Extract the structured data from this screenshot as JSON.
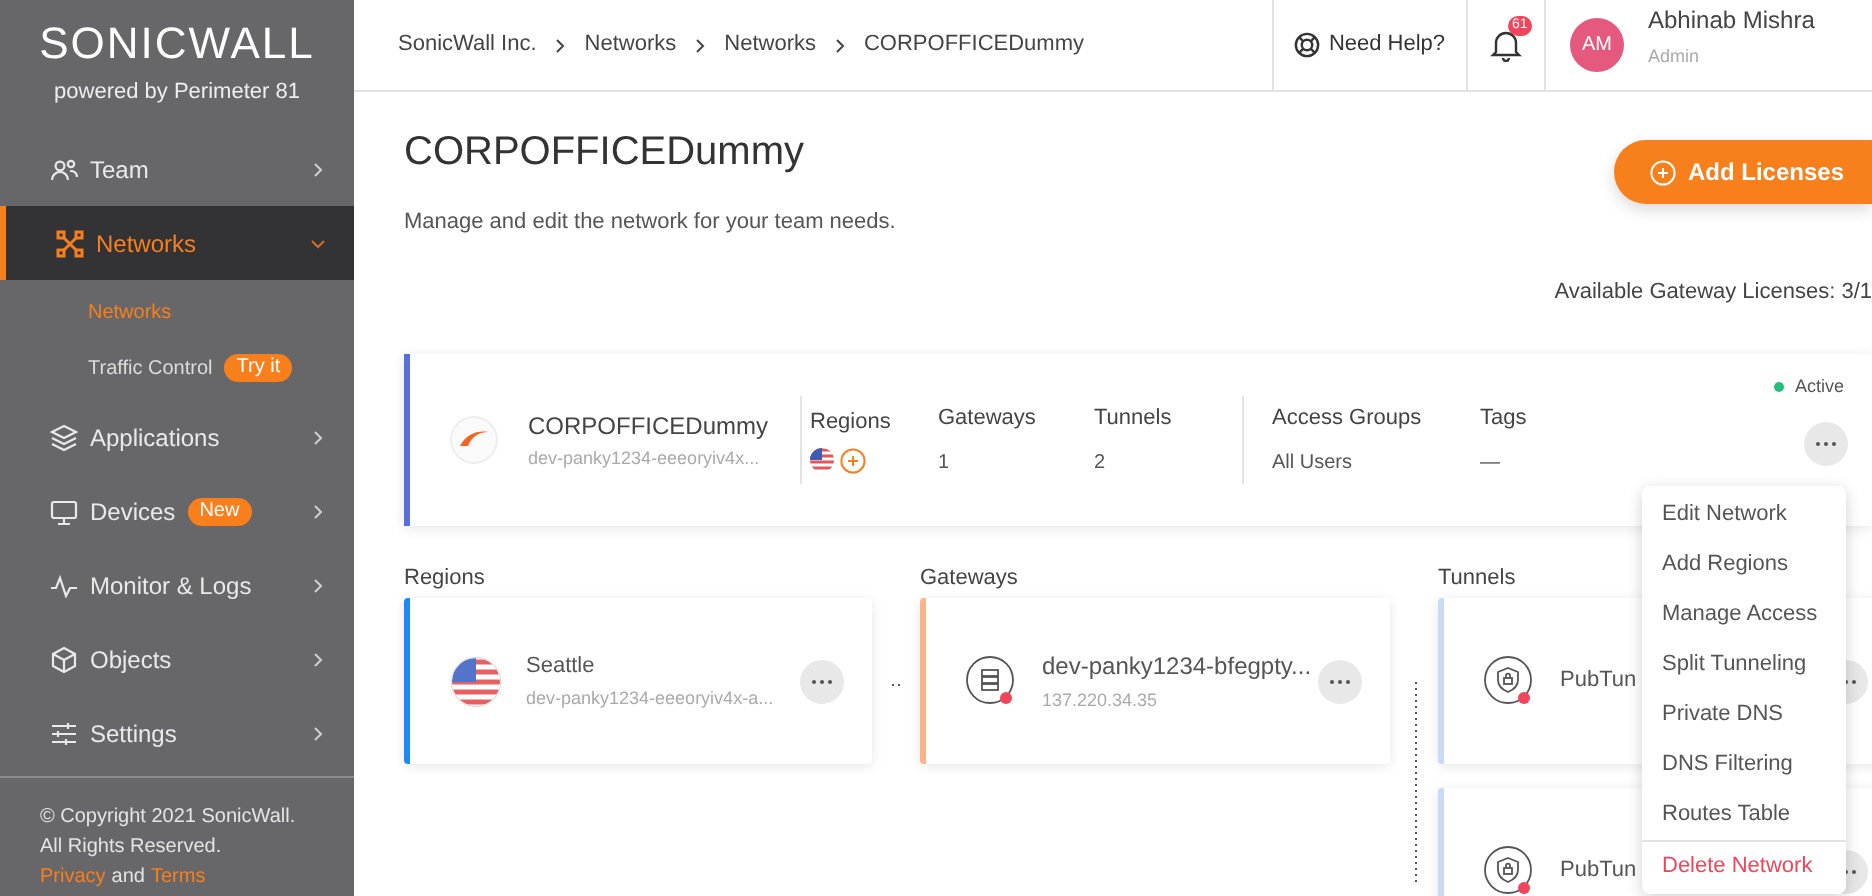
{
  "sidebar": {
    "logo": "SONIC**WALL**",
    "tagline": "powered by Perimeter 81",
    "items": [
      {
        "label": "Team",
        "selected": false,
        "expanded": false
      },
      {
        "label": "Networks",
        "selected": true,
        "expanded": true,
        "children": [
          {
            "label": "Networks",
            "selected": true
          },
          {
            "label": "Traffic Control",
            "selected": false,
            "badge": "Try it"
          }
        ]
      },
      {
        "label": "Applications",
        "selected": false,
        "expanded": false
      },
      {
        "label": "Devices",
        "selected": false,
        "expanded": false,
        "badge": "New"
      },
      {
        "label": "Monitor & Logs",
        "selected": false,
        "expanded": false
      },
      {
        "label": "Objects",
        "selected": false,
        "expanded": false
      },
      {
        "label": "Settings",
        "selected": false,
        "expanded": false
      }
    ],
    "footer": {
      "copyright": "© Copyright 2021 SonicWall. All Rights Reserved.",
      "privacy": "Privacy",
      "and": "and",
      "terms": "Terms"
    }
  },
  "header": {
    "breadcrumbs": [
      "SonicWall Inc.",
      "Networks",
      "Networks",
      "CORPOFFICEDummy"
    ],
    "help": "Need Help?",
    "notifications": "61",
    "user": {
      "initials": "AM",
      "name": "Abhinab Mishra",
      "role": "Admin"
    }
  },
  "page": {
    "title": "CORPOFFICEDummy",
    "subtitle": "Manage and edit the network for your team needs.",
    "add_button": "Add Licenses",
    "licenses": "Available Gateway Licenses: 3/1"
  },
  "network": {
    "name": "CORPOFFICEDummy",
    "subtitle": "dev-panky1234-eeeoryiv4x...",
    "status": "Active",
    "columns": [
      {
        "label": "Regions",
        "kind": "icons"
      },
      {
        "label": "Gateways",
        "kind": "text",
        "value": "1"
      },
      {
        "label": "Tunnels",
        "kind": "text",
        "value": "2"
      },
      {
        "label": "Access Groups",
        "kind": "text",
        "value": "All Users"
      },
      {
        "label": "Tags",
        "kind": "text",
        "value": "—"
      }
    ]
  },
  "sections": [
    {
      "title": "Regions",
      "cards": [
        {
          "kind": "region",
          "name": "Seattle",
          "detail": "dev-panky1234-eeeoryiv4x-a...",
          "color": "#1e88f5"
        }
      ]
    },
    {
      "title": "Gateways",
      "cards": [
        {
          "kind": "gateway",
          "name": "dev-panky1234-bfegpty...",
          "detail": "137.220.34.35",
          "color": "#f9b58a"
        }
      ]
    },
    {
      "title": "Tunnels",
      "cards": [
        {
          "kind": "tunnel",
          "name": "PubTun",
          "color": "#c8daf6"
        },
        {
          "kind": "tunnel",
          "name": "PubTun",
          "color": "#c8daf6"
        }
      ]
    }
  ],
  "menu": [
    {
      "label": "Edit Network",
      "danger": false
    },
    {
      "label": "Add Regions",
      "danger": false
    },
    {
      "label": "Manage Access",
      "danger": false
    },
    {
      "label": "Split Tunneling",
      "danger": false
    },
    {
      "label": "Private DNS",
      "danger": false
    },
    {
      "label": "DNS Filtering",
      "danger": false
    },
    {
      "label": "Routes Table",
      "danger": false
    },
    {
      "label": "Delete Network",
      "danger": true
    }
  ]
}
